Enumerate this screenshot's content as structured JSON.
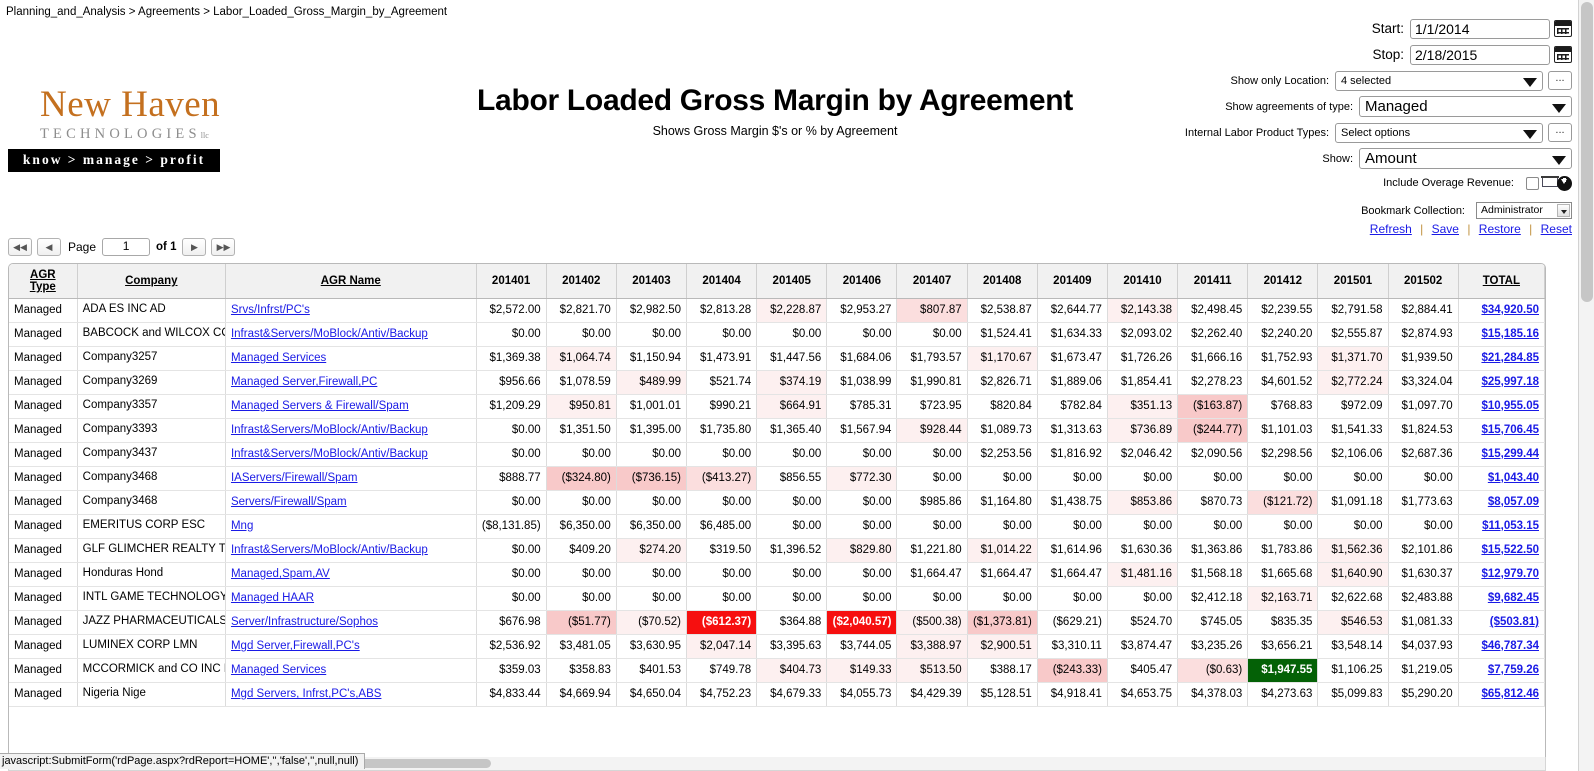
{
  "breadcrumb": "Planning_and_Analysis > Agreements > Labor_Loaded_Gross_Margin_by_Agreement",
  "logo": {
    "name": "New Haven",
    "sub": "TECHNOLOGIES",
    "tm": "llc",
    "tagline": "know > manage > profit"
  },
  "report": {
    "title": "Labor Loaded Gross Margin by Agreement",
    "subtitle": "Shows Gross Margin $'s or % by Agreement"
  },
  "controls": {
    "start_label": "Start:",
    "start_value": "1/1/2014",
    "stop_label": "Stop:",
    "stop_value": "2/18/2015",
    "location_label": "Show only Location:",
    "location_value": "4 selected",
    "agreement_type_label": "Show agreements of type:",
    "agreement_type_value": "Managed",
    "internal_labor_label": "Internal Labor Product Types:",
    "internal_labor_value": "Select options",
    "show_label": "Show:",
    "show_value": "Amount",
    "overage_label": "Include Overage Revenue:",
    "bookmark_label": "Bookmark Collection:",
    "bookmark_value": "Administrator",
    "ellipsis": "...",
    "links": {
      "refresh": "Refresh",
      "save": "Save",
      "restore": "Restore",
      "reset": "Reset",
      "sep": "|"
    }
  },
  "pager": {
    "first": "◀◀",
    "prev": "◀",
    "page_label": "Page",
    "page_value": "1",
    "of_label": "of 1",
    "next": "▶",
    "last": "▶▶"
  },
  "table": {
    "headers": [
      "AGR Type",
      "Company",
      "AGR Name",
      "201401",
      "201402",
      "201403",
      "201404",
      "201405",
      "201406",
      "201407",
      "201408",
      "201409",
      "201410",
      "201411",
      "201412",
      "201501",
      "201502",
      "TOTAL"
    ],
    "rows": [
      {
        "type": "Managed",
        "company": "ADA ES INC AD",
        "agr": "Srvs/Infrst/PC's",
        "values": [
          "$2,572.00",
          "$2,821.70",
          "$2,982.50",
          "$2,813.28",
          "$2,228.87",
          "$2,953.27",
          "$807.87",
          "$2,538.87",
          "$2,644.77",
          "$2,143.38",
          "$2,498.45",
          "$2,239.55",
          "$2,791.58",
          "$2,884.41"
        ],
        "heat": [
          "",
          "",
          "",
          "",
          "hl1",
          "",
          "hl2",
          "",
          "",
          "hl1",
          "",
          "",
          "",
          "",
          ""
        ],
        "total": "$34,920.50"
      },
      {
        "type": "Managed",
        "company": "BABCOCK and WILCOX COMPAN B",
        "agr": "Infrast&Servers/MoBlock/Antiv/Backup",
        "values": [
          "$0.00",
          "$0.00",
          "$0.00",
          "$0.00",
          "$0.00",
          "$0.00",
          "$0.00",
          "$1,524.41",
          "$1,634.33",
          "$2,093.02",
          "$2,262.40",
          "$2,240.20",
          "$2,555.87",
          "$2,874.93"
        ],
        "heat": [
          "",
          "",
          "",
          "",
          "",
          "",
          "",
          "",
          "",
          "",
          "",
          "",
          "",
          ""
        ],
        "total": "$15,185.16"
      },
      {
        "type": "Managed",
        "company": "Company3257",
        "agr": "Managed Services",
        "values": [
          "$1,369.38",
          "$1,064.74",
          "$1,150.94",
          "$1,473.91",
          "$1,447.56",
          "$1,684.06",
          "$1,793.57",
          "$1,170.67",
          "$1,673.47",
          "$1,726.26",
          "$1,666.16",
          "$1,752.93",
          "$1,371.70",
          "$1,939.50"
        ],
        "heat": [
          "",
          "hl1",
          "",
          "",
          "",
          "",
          "",
          "hl1",
          "",
          "",
          "",
          "",
          "hl1",
          ""
        ],
        "total": "$21,284.85"
      },
      {
        "type": "Managed",
        "company": "Company3269",
        "agr": "Managed Server,Firewall,PC",
        "values": [
          "$956.66",
          "$1,078.59",
          "$489.99",
          "$521.74",
          "$374.19",
          "$1,038.99",
          "$1,990.81",
          "$2,826.71",
          "$1,889.06",
          "$1,854.41",
          "$2,278.23",
          "$4,601.52",
          "$2,772.24",
          "$3,324.04"
        ],
        "heat": [
          "",
          "",
          "hl1",
          "",
          "hl1",
          "",
          "",
          "",
          "",
          "",
          "",
          "",
          "hl1",
          ""
        ],
        "total": "$25,997.18"
      },
      {
        "type": "Managed",
        "company": "Company3357",
        "agr": "Managed Servers & Firewall/Spam",
        "values": [
          "$1,209.29",
          "$950.81",
          "$1,001.01",
          "$990.21",
          "$664.91",
          "$785.31",
          "$723.95",
          "$820.84",
          "$782.84",
          "$351.13",
          "($163.87)",
          "$768.83",
          "$972.09",
          "$1,097.70"
        ],
        "heat": [
          "",
          "hl1",
          "",
          "",
          "hl1",
          "",
          "",
          "",
          "",
          "hl1",
          "hl3",
          "",
          "",
          ""
        ],
        "total": "$10,955.05"
      },
      {
        "type": "Managed",
        "company": "Company3393",
        "agr": "Infrast&Servers/MoBlock/Antiv/Backup",
        "values": [
          "$0.00",
          "$1,351.50",
          "$1,395.00",
          "$1,735.80",
          "$1,365.40",
          "$1,567.94",
          "$928.44",
          "$1,089.73",
          "$1,313.63",
          "$736.89",
          "($244.77)",
          "$1,101.03",
          "$1,541.33",
          "$1,824.53"
        ],
        "heat": [
          "",
          "",
          "",
          "",
          "",
          "",
          "hl1",
          "",
          "",
          "hl1",
          "hl3",
          "",
          "",
          ""
        ],
        "total": "$15,706.45"
      },
      {
        "type": "Managed",
        "company": "Company3437",
        "agr": "Infrast&Servers/MoBlock/Antiv/Backup",
        "values": [
          "$0.00",
          "$0.00",
          "$0.00",
          "$0.00",
          "$0.00",
          "$0.00",
          "$0.00",
          "$2,253.56",
          "$1,816.92",
          "$2,046.42",
          "$2,090.56",
          "$2,298.56",
          "$2,106.06",
          "$2,687.36"
        ],
        "heat": [
          "",
          "",
          "",
          "",
          "",
          "",
          "",
          "",
          "",
          "",
          "",
          "",
          "",
          ""
        ],
        "total": "$15,299.44"
      },
      {
        "type": "Managed",
        "company": "Company3468",
        "agr": "IAServers/Firewall/Spam",
        "values": [
          "$888.77",
          "($324.80)",
          "($736.15)",
          "($413.27)",
          "$856.55",
          "$772.30",
          "$0.00",
          "$0.00",
          "$0.00",
          "$0.00",
          "$0.00",
          "$0.00",
          "$0.00",
          "$0.00"
        ],
        "heat": [
          "",
          "hl3",
          "hl3",
          "hl2",
          "",
          "hl1",
          "",
          "",
          "",
          "",
          "",
          "",
          "",
          ""
        ],
        "total": "$1,043.40"
      },
      {
        "type": "Managed",
        "company": "Company3468",
        "agr": "Servers/Firewall/Spam",
        "values": [
          "$0.00",
          "$0.00",
          "$0.00",
          "$0.00",
          "$0.00",
          "$0.00",
          "$985.86",
          "$1,164.80",
          "$1,438.75",
          "$853.86",
          "$870.73",
          "($121.72)",
          "$1,091.18",
          "$1,773.63"
        ],
        "heat": [
          "",
          "",
          "",
          "",
          "",
          "",
          "",
          "",
          "",
          "hl1",
          "",
          "hl2",
          "",
          ""
        ],
        "total": "$8,057.09"
      },
      {
        "type": "Managed",
        "company": "EMERITUS CORP ESC",
        "agr": "Mng",
        "values": [
          "($8,131.85)",
          "$6,350.00",
          "$6,350.00",
          "$6,485.00",
          "$0.00",
          "$0.00",
          "$0.00",
          "$0.00",
          "$0.00",
          "$0.00",
          "$0.00",
          "$0.00",
          "$0.00",
          "$0.00"
        ],
        "heat": [
          "",
          "",
          "",
          "",
          "",
          "",
          "",
          "",
          "",
          "",
          "",
          "",
          "",
          ""
        ],
        "total": "$11,053.15"
      },
      {
        "type": "Managed",
        "company": "GLF GLIMCHER REALTY TRUST G",
        "agr": "Infrast&Servers/MoBlock/Antiv/Backup",
        "values": [
          "$0.00",
          "$409.20",
          "$274.20",
          "$319.50",
          "$1,396.52",
          "$829.80",
          "$1,221.80",
          "$1,014.22",
          "$1,614.96",
          "$1,630.36",
          "$1,363.86",
          "$1,783.86",
          "$1,562.36",
          "$2,101.86"
        ],
        "heat": [
          "",
          "",
          "hl1",
          "",
          "",
          "hl1",
          "",
          "hl1",
          "",
          "",
          "",
          "",
          "hl1",
          ""
        ],
        "total": "$15,522.50"
      },
      {
        "type": "Managed",
        "company": "Honduras Hond",
        "agr": "Managed,Spam,AV",
        "values": [
          "$0.00",
          "$0.00",
          "$0.00",
          "$0.00",
          "$0.00",
          "$0.00",
          "$1,664.47",
          "$1,664.47",
          "$1,664.47",
          "$1,481.16",
          "$1,568.18",
          "$1,665.68",
          "$1,640.90",
          "$1,630.37"
        ],
        "heat": [
          "",
          "",
          "",
          "",
          "",
          "",
          "",
          "",
          "",
          "hl1",
          "",
          "",
          "hl1",
          ""
        ],
        "total": "$12,979.70"
      },
      {
        "type": "Managed",
        "company": "INTL GAME TECHNOLOGY IG",
        "agr": "Managed HAAR",
        "values": [
          "$0.00",
          "$0.00",
          "$0.00",
          "$0.00",
          "$0.00",
          "$0.00",
          "$0.00",
          "$0.00",
          "$0.00",
          "$0.00",
          "$2,412.18",
          "$2,163.71",
          "$2,622.68",
          "$2,483.88"
        ],
        "heat": [
          "",
          "",
          "",
          "",
          "",
          "",
          "",
          "",
          "",
          "",
          "",
          "hl1",
          "",
          ""
        ],
        "total": "$9,682.45"
      },
      {
        "type": "Managed",
        "company": "JAZZ PHARMACEUTICALS PL JA",
        "agr": "Server/Infrastructure/Sophos",
        "values": [
          "$676.98",
          "($51.77)",
          "($70.52)",
          "($612.37)",
          "$364.88",
          "($2,040.57)",
          "($500.38)",
          "($1,373.81)",
          "($629.21)",
          "$524.70",
          "$745.05",
          "$835.35",
          "$546.53",
          "$1,081.33"
        ],
        "heat": [
          "",
          "hl3",
          "hl1",
          "hl4",
          "",
          "hl4",
          "hl1",
          "hl3",
          "",
          "",
          "",
          "",
          "hl1",
          ""
        ],
        "total": "($503.81)"
      },
      {
        "type": "Managed",
        "company": "LUMINEX CORP LMN",
        "agr": "Mgd Server,Firewall,PC's",
        "values": [
          "$2,536.92",
          "$3,481.05",
          "$3,630.95",
          "$2,047.14",
          "$3,395.63",
          "$3,744.05",
          "$3,388.97",
          "$2,900.51",
          "$3,310.11",
          "$3,874.47",
          "$3,235.26",
          "$3,656.21",
          "$3,548.14",
          "$4,037.93"
        ],
        "heat": [
          "",
          "",
          "",
          "hl1",
          "",
          "",
          "hl1",
          "hl1",
          "",
          "",
          "",
          "",
          "",
          ""
        ],
        "total": "$46,787.34"
      },
      {
        "type": "Managed",
        "company": "MCCORMICK and CO INC M",
        "agr": "Managed Services",
        "values": [
          "$359.03",
          "$358.83",
          "$401.53",
          "$749.78",
          "$404.73",
          "$149.33",
          "$513.50",
          "$388.17",
          "($243.33)",
          "$405.47",
          "($0.63)",
          "$1,947.55",
          "$1,106.25",
          "$1,219.05"
        ],
        "heat": [
          "",
          "",
          "",
          "",
          "hl1",
          "hl1",
          "hl1",
          "",
          "hl3",
          "",
          "hl2",
          "gl1",
          "",
          ""
        ],
        "total": "$7,759.26"
      },
      {
        "type": "Managed",
        "company": "Nigeria Nige",
        "agr": "Mgd Servers, Infrst,PC's,ABS",
        "values": [
          "$4,833.44",
          "$4,669.94",
          "$4,650.04",
          "$4,752.23",
          "$4,679.33",
          "$4,055.73",
          "$4,429.39",
          "$5,128.51",
          "$4,918.41",
          "$4,653.75",
          "$4,378.03",
          "$4,273.63",
          "$5,099.83",
          "$5,290.20"
        ],
        "heat": [
          "",
          "",
          "",
          "",
          "",
          "",
          "",
          "",
          "",
          "",
          "",
          "",
          "",
          ""
        ],
        "total": "$65,812.46"
      }
    ]
  },
  "statusbar": "javascript:SubmitForm('rdPage.aspx?rdReport=HOME','','false','',null,null)"
}
